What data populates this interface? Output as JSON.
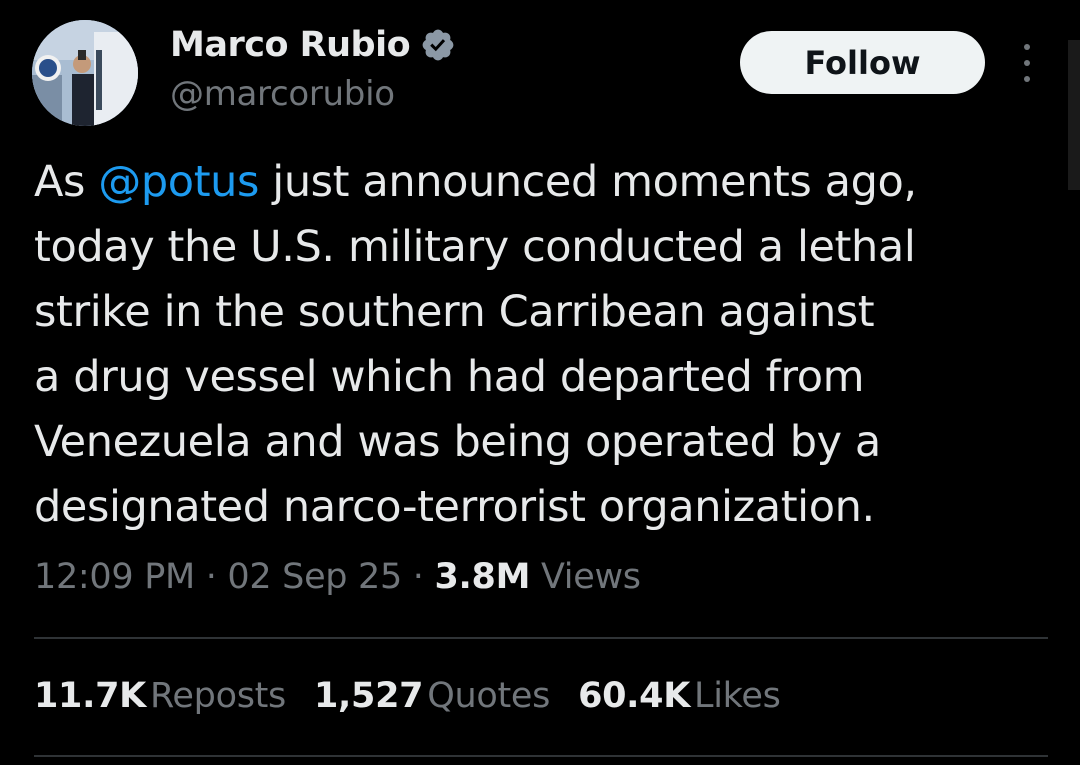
{
  "author": {
    "display_name": "Marco Rubio",
    "handle": "@marcorubio",
    "verified_icon": "verified-badge-icon",
    "verified_color": "#8b98a5"
  },
  "actions": {
    "follow_label": "Follow",
    "more_icon": "more-options-icon"
  },
  "tweet": {
    "lines": [
      {
        "before": "As ",
        "mention": "@potus",
        "after": " just announced moments ago,"
      },
      {
        "text": "today the U.S. military conducted a lethal"
      },
      {
        "text": "strike in the southern Carribean against"
      },
      {
        "text": "a drug vessel which had departed from"
      },
      {
        "text": "Venezuela and was being operated by a"
      },
      {
        "text": "designated narco-terrorist organization."
      }
    ],
    "mention_color": "#1d9bf0"
  },
  "meta": {
    "time": "12:09 PM",
    "sep1": " · ",
    "date": "02 Sep 25",
    "sep2": " · ",
    "views_count": "3.8M",
    "views_label": "Views"
  },
  "stats": {
    "reposts_count": "11.7K",
    "reposts_label": "Reposts",
    "quotes_count": "1,527",
    "quotes_label": "Quotes",
    "likes_count": "60.4K",
    "likes_label": "Likes"
  },
  "colors": {
    "background": "#000000",
    "text_primary": "#e7e9ea",
    "text_secondary": "#71767b",
    "divider": "#2f3336",
    "follow_bg": "#eff3f4"
  }
}
